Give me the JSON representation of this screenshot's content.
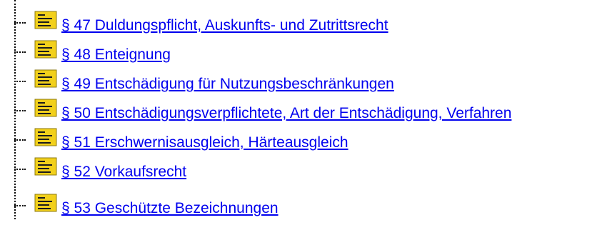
{
  "tree": {
    "items": [
      {
        "label": "§ 47 Duldungspflicht, Auskunfts- und Zutrittsrecht"
      },
      {
        "label": "§ 48 Enteignung"
      },
      {
        "label": "§ 49 Entschädigung für Nutzungsbeschränkungen"
      },
      {
        "label": "§ 50 Entschädigungsverpflichtete, Art der Entschädigung, Verfahren"
      },
      {
        "label": "§ 51 Erschwernisausgleich, Härteausgleich"
      },
      {
        "label": "§ 52 Vorkaufsrecht"
      },
      {
        "label": "§ 53 Geschützte Bezeichnungen"
      }
    ],
    "icon": "document-icon",
    "link_color": "#0000ee",
    "icon_color": "#f2d01b"
  }
}
